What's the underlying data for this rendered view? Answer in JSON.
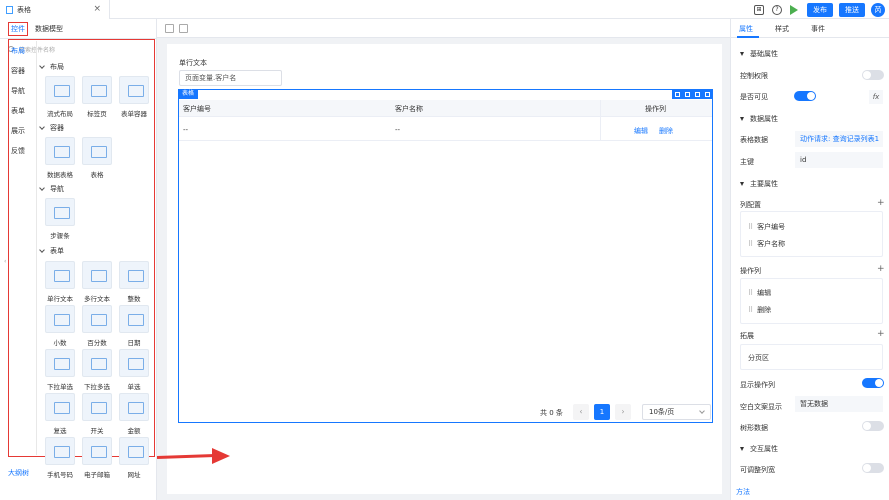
{
  "tab": {
    "title": "表格",
    "close": "×"
  },
  "topbar": {
    "publish": "发布",
    "push": "推送",
    "avatar": "芮",
    "icon1": "⊞",
    "icon2": "?"
  },
  "left": {
    "tabs": [
      "控件",
      "数据模型"
    ],
    "search_placeholder": "搜索控件名称",
    "categories": [
      "布局",
      "容器",
      "导航",
      "表单",
      "展示",
      "反馈"
    ],
    "groups": [
      "布局",
      "容器",
      "导航",
      "表单"
    ],
    "components": {
      "layout": [
        "流式布局",
        "标签页",
        "表单容器"
      ],
      "container": [
        "数据表格",
        "表格"
      ],
      "nav": [
        "步骤条"
      ],
      "form": [
        "单行文本",
        "多行文本",
        "整数",
        "小数",
        "百分数",
        "日期",
        "下拉单选",
        "下拉多选",
        "单选",
        "复选",
        "开关",
        "金额",
        "手机号码",
        "电子邮箱",
        "网址"
      ]
    },
    "bottom_link": "大纲树"
  },
  "canvas": {
    "single_label": "单行文本",
    "single_value": "页面变量.客户名",
    "table_tag": "表格",
    "columns": [
      "客户编号",
      "客户名称",
      "操作列"
    ],
    "row": [
      "--",
      "--"
    ],
    "actions": [
      "编辑",
      "删除"
    ],
    "pager_total": "共 0 条",
    "pager_current": "1",
    "pager_size": "10条/页",
    "prev": "‹",
    "next": "›"
  },
  "right": {
    "tabs": [
      "属性",
      "样式",
      "事件"
    ],
    "sections": [
      "基础属性",
      "数据属性",
      "主要属性",
      "交互属性"
    ],
    "labels": {
      "perm": "控制权限",
      "visible": "是否可见",
      "table_data": "表格数据",
      "key": "主键",
      "col_config": "列配置",
      "op_col": "操作列",
      "expand": "拓展",
      "show_op": "显示操作列",
      "empty_text": "空白文案显示",
      "tree_data": "树形数据",
      "resizable": "可调整列宽"
    },
    "values": {
      "table_data": "动作请求: 查询记录列表1",
      "key": "id",
      "empty_text": "暂无数据"
    },
    "col_items": [
      "客户编号",
      "客户名称"
    ],
    "op_items": [
      "编辑",
      "删除"
    ],
    "expand_items": [
      "分页区"
    ],
    "toggles": {
      "perm": false,
      "visible": true,
      "show_op": true,
      "tree_data": false,
      "resizable": false
    },
    "fx": "fx",
    "plus": "+",
    "bottom_link": "方法"
  }
}
